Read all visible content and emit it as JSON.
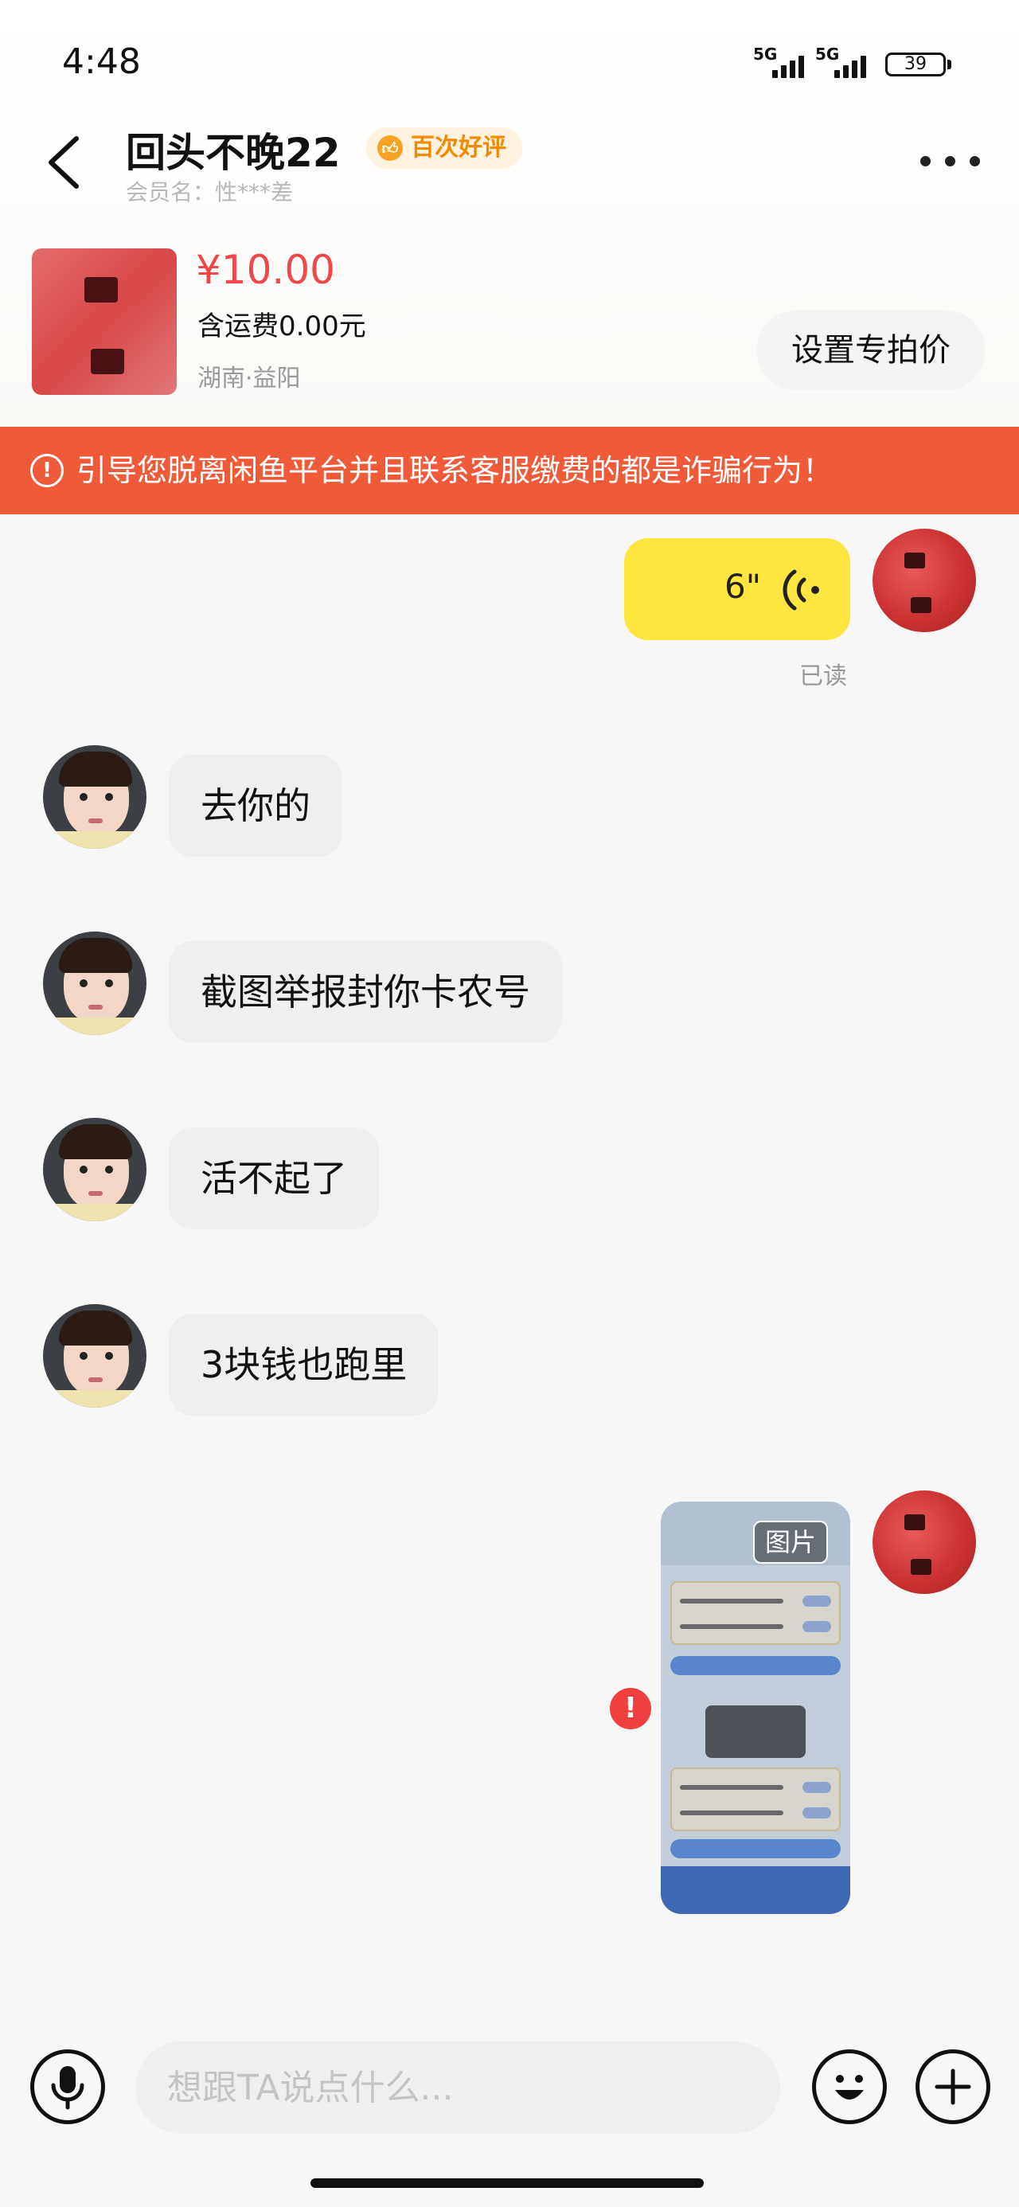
{
  "status_bar": {
    "time": "4:48",
    "signal1_label": "5G",
    "signal2_label": "5G",
    "battery": "39"
  },
  "header": {
    "title": "回头不晚22",
    "badge": "百次好评",
    "member_name": "会员名：性***差"
  },
  "product": {
    "price": "¥10.00",
    "shipping": "含运费0.00元",
    "location": "湖南·益阳",
    "action_label": "设置专拍价"
  },
  "warning": {
    "text": "引导您脱离闲鱼平台并且联系客服缴费的都是诈骗行为！"
  },
  "messages": {
    "voice": {
      "duration": "6\"",
      "read_status": "已读"
    },
    "other1": "去你的",
    "other2": "截图举报封你卡农号",
    "other3": "活不起了",
    "other4": "3块钱也跑里",
    "image_label": "图片",
    "error_mark": "!"
  },
  "input_bar": {
    "placeholder": "想跟TA说点什么..."
  },
  "colors": {
    "warning_bg": "#ef5b38",
    "price": "#f04848",
    "voice_bubble": "#ffe640",
    "badge_text": "#f08a00"
  }
}
